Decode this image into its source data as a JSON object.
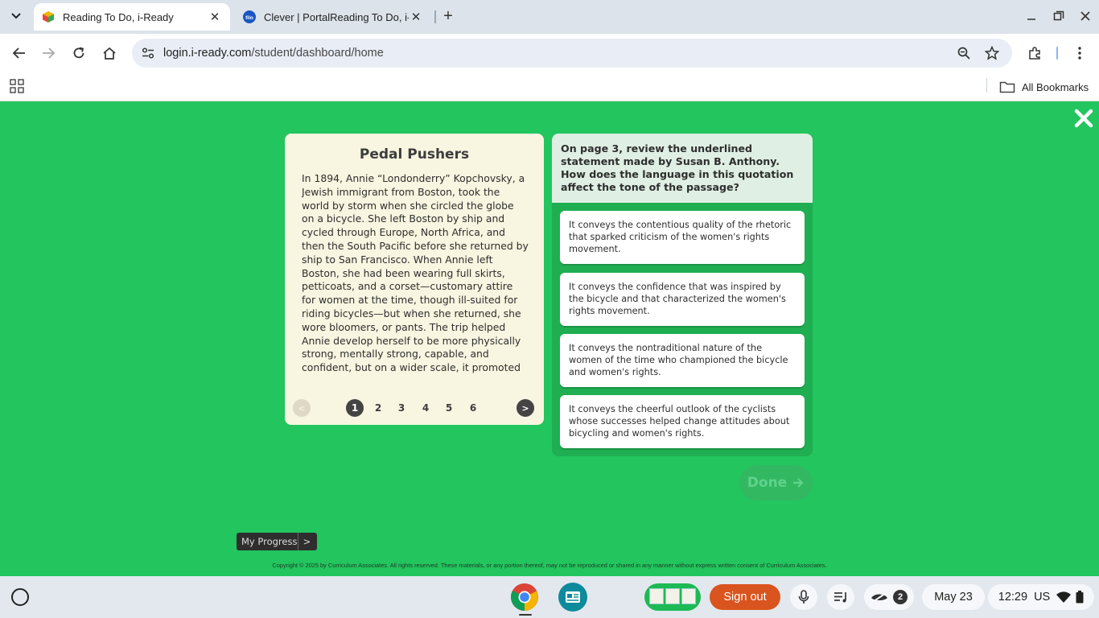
{
  "browser": {
    "tabs": [
      {
        "title": "Reading To Do, i-Ready",
        "favicon": "iready-cube-icon",
        "active": true
      },
      {
        "title": "Clever | PortalReading To Do, i-Ready",
        "favicon": "filo-icon",
        "active": false
      }
    ],
    "url_host": "login.i-ready.com",
    "url_path": "/student/dashboard/home",
    "bookmarks_label": "All Bookmarks"
  },
  "passage": {
    "title": "Pedal Pushers",
    "text": "In 1894, Annie “Londonderry” Kopchovsky, a Jewish immigrant from Boston, took the world by storm when she circled the globe on a bicycle. She left Boston by ship and cycled through Europe, North Africa, and then the South Pacific before she returned by ship to San Francisco. When Annie left Boston, she had been wearing full skirts, petticoats, and a corset—customary attire for women at the time, though ill-suited for riding bicycles—but when she returned, she wore bloomers, or pants. The trip helped Annie develop herself to be more physically strong, mentally strong, capable, and confident, but on a wider scale, it promoted progress. Her groundbreaking trip",
    "pager": {
      "prev": "<",
      "next": ">",
      "pages": [
        "1",
        "2",
        "3",
        "4",
        "5",
        "6"
      ],
      "current_page": "1"
    }
  },
  "question": {
    "prompt": "On page 3, review the underlined statement made by Susan B. Anthony. How does the language in this quotation affect the tone of the passage?",
    "answers": [
      "It conveys the contentious quality of the rhetoric that sparked criticism of the women's rights movement.",
      "It conveys the confidence that was inspired by the bicycle and that characterized the women's rights movement.",
      "It conveys the nontraditional nature of the women of the time who championed the bicycle and women's rights.",
      "It conveys the cheerful outlook of the cyclists whose successes helped change attitudes about bicycling and women's rights."
    ]
  },
  "done_label": "Done",
  "progress": {
    "label": "My Progress",
    "chevron": ">"
  },
  "copyright": "Copyright © 2025 by Curriculum Associates. All rights reserved. These materials, or any portion thereof, may not be reproduced or shared in any manner without express written consent of Curriculum Associates.",
  "shelf": {
    "sign_out": "Sign out",
    "notification_count": "2",
    "date": "May 23",
    "time": "12:29",
    "locale": "US"
  },
  "colors": {
    "page_bg": "#22c55e",
    "passage_bg": "#f8f5e0",
    "question_bg": "#1fae52",
    "signout_bg": "#d9541e"
  }
}
